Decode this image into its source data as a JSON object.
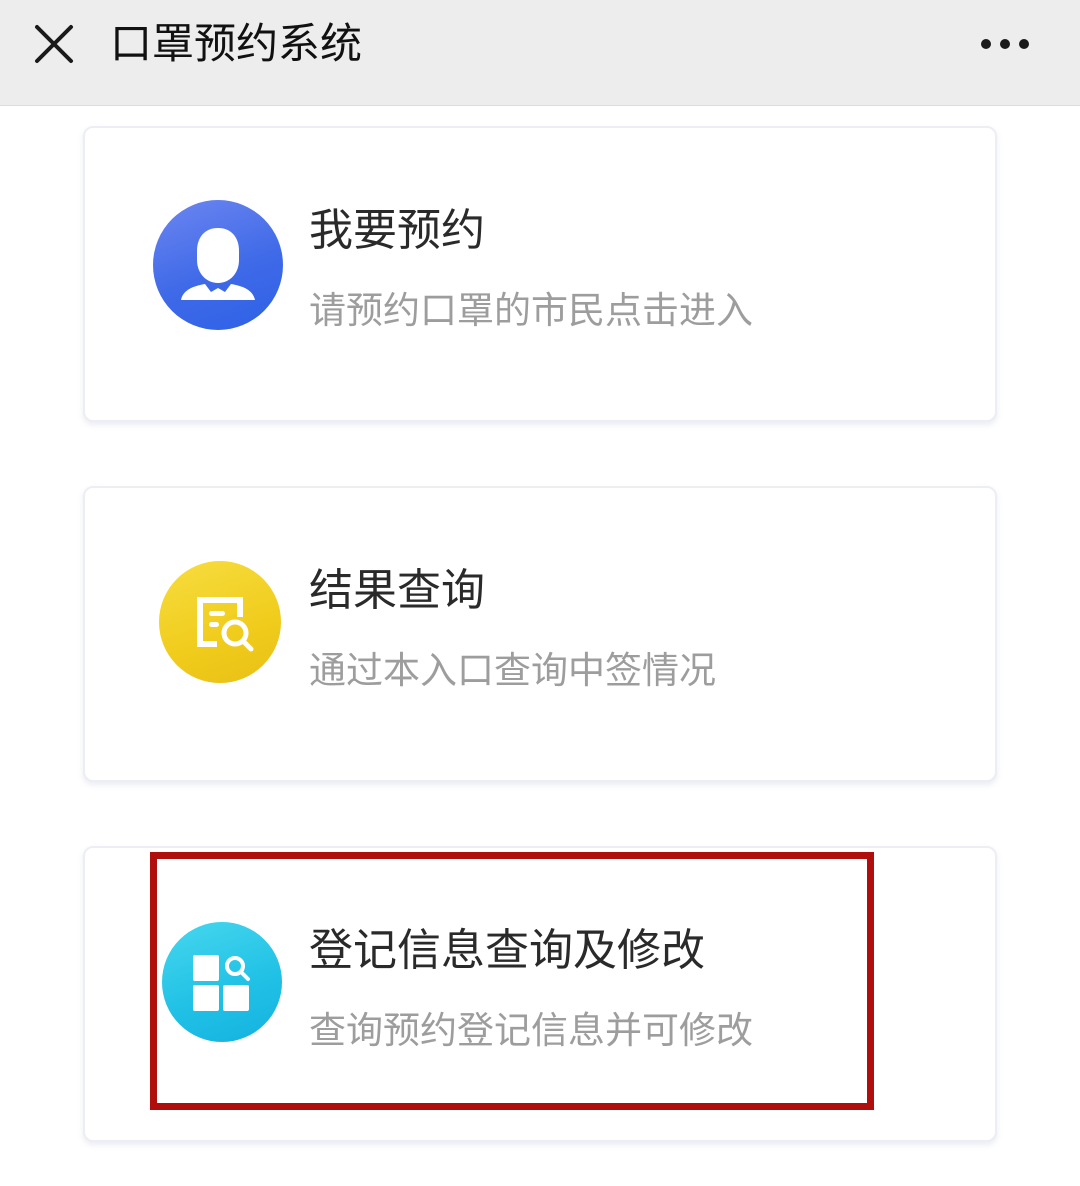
{
  "header": {
    "title": "口罩预约系统",
    "close_icon": "close-icon",
    "more_icon": "more-icon"
  },
  "cards": [
    {
      "icon": "user-avatar-icon",
      "title": "我要预约",
      "subtitle": "请预约口罩的市民点击进入",
      "color": "#3f6ae8"
    },
    {
      "icon": "result-search-icon",
      "title": "结果查询",
      "subtitle": "通过本入口查询中签情况",
      "color": "#f0cc1c"
    },
    {
      "icon": "grid-search-icon",
      "title": "登记信息查询及修改",
      "subtitle": "查询预约登记信息并可修改",
      "color": "#22c2e6"
    }
  ],
  "highlight": {
    "color": "#b00d0d"
  }
}
